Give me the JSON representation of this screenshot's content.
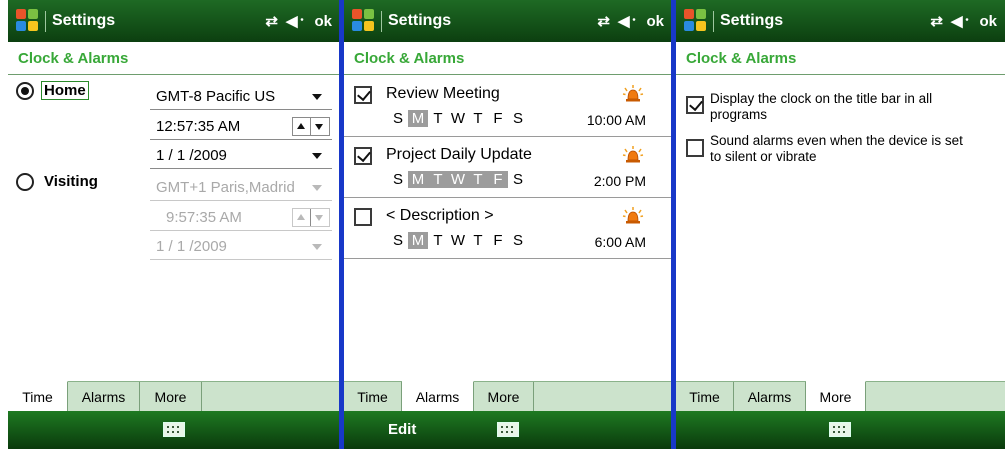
{
  "colors": {
    "title_bar": "#145a18",
    "section_heading": "#38a838",
    "divider": "#1838c8",
    "tab_strip": "#cce3cc",
    "alarm_bell": "#f07a10"
  },
  "screens": [
    {
      "title": "Settings",
      "status_ok": "ok",
      "section": "Clock & Alarms",
      "home_label": "Home",
      "visiting_label": "Visiting",
      "home": {
        "timezone": "GMT-8 Pacific US",
        "time": "12:57:35 AM",
        "date": "1 / 1 /2009"
      },
      "visiting": {
        "timezone": "GMT+1 Paris,Madrid",
        "time": "9:57:35 AM",
        "date": "1 / 1 /2009"
      },
      "tabs": [
        "Time",
        "Alarms",
        "More"
      ],
      "active_tab": "Time",
      "softkey_left": ""
    },
    {
      "title": "Settings",
      "status_ok": "ok",
      "section": "Clock & Alarms",
      "alarms": [
        {
          "checked": true,
          "desc": "Review Meeting",
          "days": [
            "S",
            "M",
            "T",
            "W",
            "T",
            "F",
            "S"
          ],
          "selected": [
            1
          ],
          "time": "10:00 AM"
        },
        {
          "checked": true,
          "desc": "Project Daily Update",
          "days": [
            "S",
            "M",
            "T",
            "W",
            "T",
            "F",
            "S"
          ],
          "selected": [
            1,
            2,
            3,
            4,
            5
          ],
          "time": "2:00 PM"
        },
        {
          "checked": false,
          "desc": "< Description >",
          "days": [
            "S",
            "M",
            "T",
            "W",
            "T",
            "F",
            "S"
          ],
          "selected": [
            1
          ],
          "time": "6:00 AM"
        }
      ],
      "tabs": [
        "Time",
        "Alarms",
        "More"
      ],
      "active_tab": "Alarms",
      "softkey_left": "Edit"
    },
    {
      "title": "Settings",
      "status_ok": "ok",
      "section": "Clock & Alarms",
      "options": [
        {
          "checked": true,
          "text": "Display the clock on the title bar in all programs"
        },
        {
          "checked": false,
          "text": "Sound alarms even when the device is set to silent or vibrate"
        }
      ],
      "tabs": [
        "Time",
        "Alarms",
        "More"
      ],
      "active_tab": "More",
      "softkey_left": ""
    }
  ]
}
